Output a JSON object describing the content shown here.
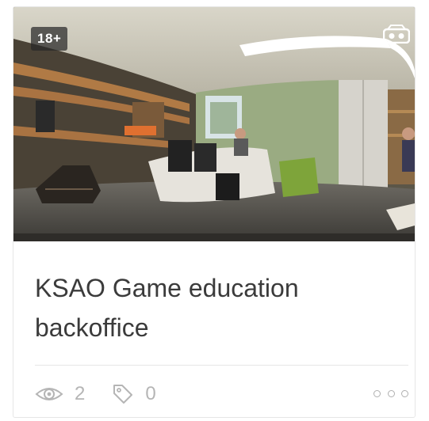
{
  "card": {
    "age_badge": "18+",
    "title": "KSAO Game education backoffice",
    "views": "2",
    "tags": "0",
    "icons": {
      "views": "eye-icon",
      "tags": "tag-icon",
      "vr": "vr-headset-icon",
      "more": "more-options-icon"
    }
  }
}
